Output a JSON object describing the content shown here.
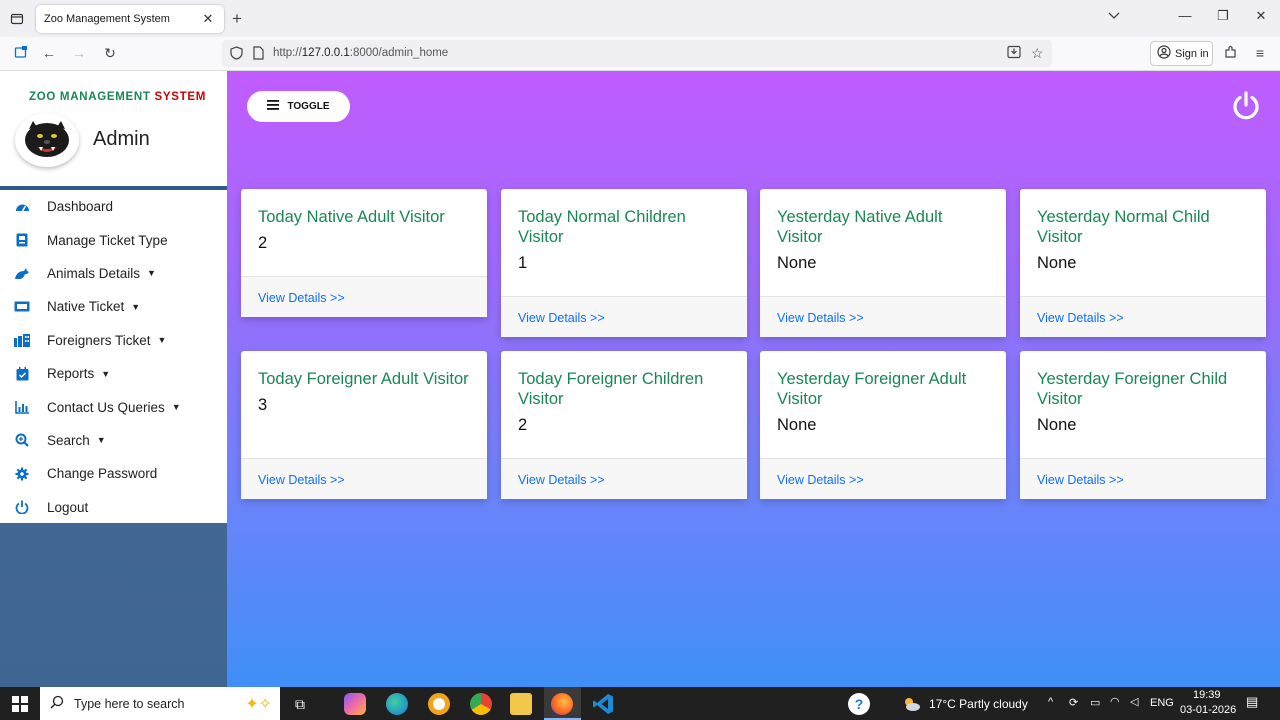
{
  "browser": {
    "tab_title": "Zoo Management System",
    "url_prefix": "http://",
    "url_host": "127.0.0.1",
    "url_rest": ":8000/admin_home",
    "sign_in": "Sign in"
  },
  "sidebar": {
    "title_part1": "ZOO MANAGEMENT ",
    "title_part2": "SYSTEM",
    "user": "Admin",
    "items": [
      {
        "label": "Dashboard",
        "icon": "dashboard-icon",
        "dropdown": false
      },
      {
        "label": "Manage Ticket Type",
        "icon": "ticket-icon",
        "dropdown": false
      },
      {
        "label": "Animals Details",
        "icon": "animal-icon",
        "dropdown": true
      },
      {
        "label": "Native Ticket",
        "icon": "ticket-alt-icon",
        "dropdown": true
      },
      {
        "label": "Foreigners Ticket",
        "icon": "building-icon",
        "dropdown": true
      },
      {
        "label": "Reports",
        "icon": "calendar-icon",
        "dropdown": true
      },
      {
        "label": "Contact Us Queries",
        "icon": "chart-icon",
        "dropdown": true
      },
      {
        "label": "Search",
        "icon": "search-icon",
        "dropdown": true
      },
      {
        "label": "Change Password",
        "icon": "gear-icon",
        "dropdown": false
      },
      {
        "label": "Logout",
        "icon": "power-icon",
        "dropdown": false
      }
    ]
  },
  "main": {
    "toggle_label": "TOGGLE",
    "view_details": "View Details >>",
    "cards": [
      {
        "title": "Today Native Adult Visitor",
        "value": "2"
      },
      {
        "title": "Today Normal Children Visitor",
        "value": "1"
      },
      {
        "title": "Yesterday Native Adult Visitor",
        "value": "None"
      },
      {
        "title": "Yesterday Normal Child Visitor",
        "value": "None"
      },
      {
        "title": "Today Foreigner Adult Visitor",
        "value": "3"
      },
      {
        "title": "Today Foreigner Children Visitor",
        "value": "2"
      },
      {
        "title": "Yesterday Foreigner Adult Visitor",
        "value": "None"
      },
      {
        "title": "Yesterday Foreigner Child Visitor",
        "value": "None"
      }
    ]
  },
  "taskbar": {
    "search_placeholder": "Type here to search",
    "weather": "17°C  Partly cloudy",
    "lang": "ENG",
    "time": "19:39",
    "date": "03-01-2026"
  }
}
